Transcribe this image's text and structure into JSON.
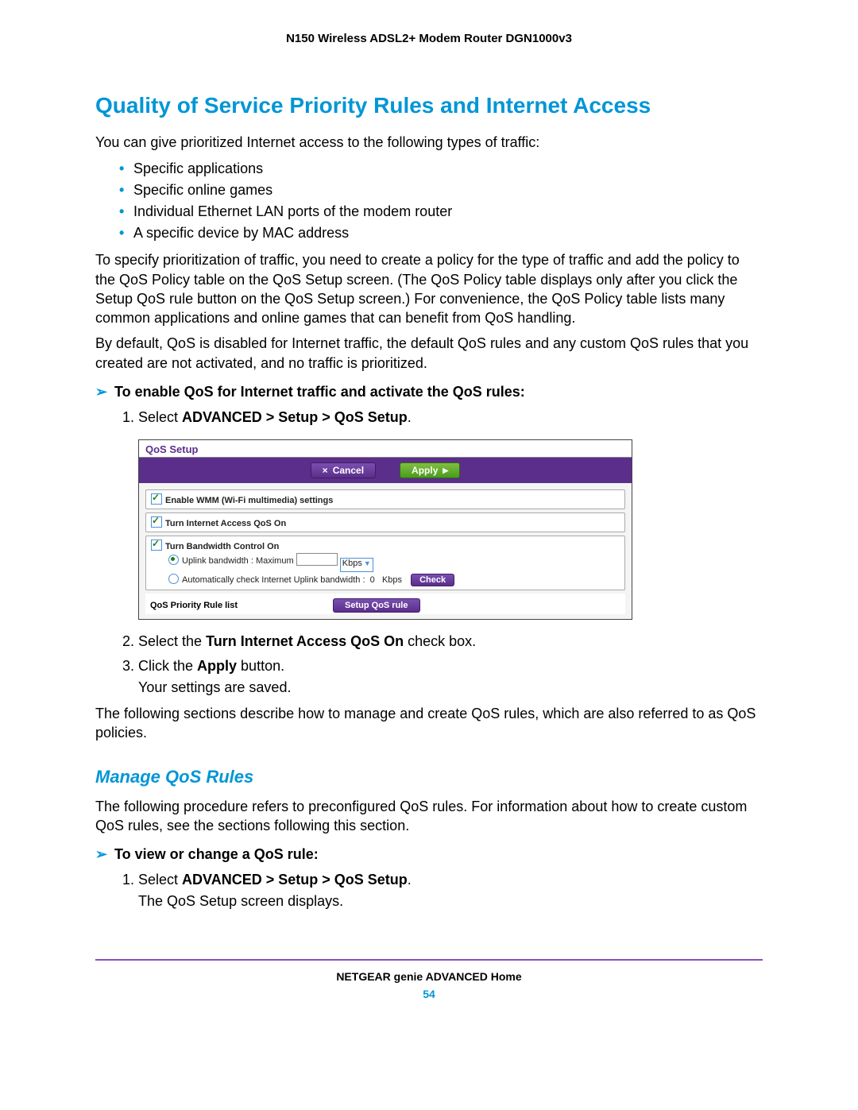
{
  "doc_header": "N150 Wireless ADSL2+ Modem Router DGN1000v3",
  "h1": "Quality of Service Priority Rules and Internet Access",
  "intro": "You can give prioritized Internet access to the following types of traffic:",
  "bullets": [
    "Specific applications",
    "Specific online games",
    "Individual Ethernet LAN ports of the modem router",
    "A specific device by MAC address"
  ],
  "para2": "To specify prioritization of traffic, you need to create a policy for the type of traffic and add the policy to the QoS Policy table on the QoS Setup screen. (The QoS Policy table displays only after you click the Setup QoS rule button on the QoS Setup screen.) For convenience, the QoS Policy table lists many common applications and online games that can benefit from QoS handling.",
  "para3": "By default, QoS is disabled for Internet traffic, the default QoS rules and any custom QoS rules that you created are not activated, and no traffic is prioritized.",
  "proc1_title": "To enable QoS for Internet traffic and activate the QoS rules:",
  "step1_prefix": "Select ",
  "step1_bold": "ADVANCED > Setup > QoS Setup",
  "shot": {
    "title": "QoS Setup",
    "cancel": "Cancel",
    "apply": "Apply",
    "row1": "Enable WMM (Wi-Fi multimedia) settings",
    "row2": "Turn Internet Access QoS On",
    "row3": "Turn Bandwidth Control On",
    "uplink": "Uplink bandwidth :   Maximum",
    "kbps": "Kbps",
    "auto": "Automatically check Internet Uplink bandwidth :",
    "autoval": "0",
    "check": "Check",
    "footlabel": "QoS Priority Rule list",
    "setup": "Setup QoS rule"
  },
  "step2_a": "Select the ",
  "step2_b": "Turn Internet Access QoS On",
  "step2_c": " check box.",
  "step3_a": "Click the ",
  "step3_b": "Apply",
  "step3_c": " button.",
  "step3_result": "Your settings are saved.",
  "para4": "The following sections describe how to manage and create QoS rules, which are also referred to as QoS policies.",
  "h2": "Manage QoS Rules",
  "para5": "The following procedure refers to preconfigured QoS rules. For information about how to create custom QoS rules, see the sections following this section.",
  "proc2_title": "To view or change a QoS rule:",
  "proc2_step1_prefix": "Select ",
  "proc2_step1_bold": "ADVANCED > Setup > QoS Setup",
  "proc2_step1_result": "The QoS Setup screen displays.",
  "footer": "NETGEAR genie ADVANCED Home",
  "page": "54"
}
